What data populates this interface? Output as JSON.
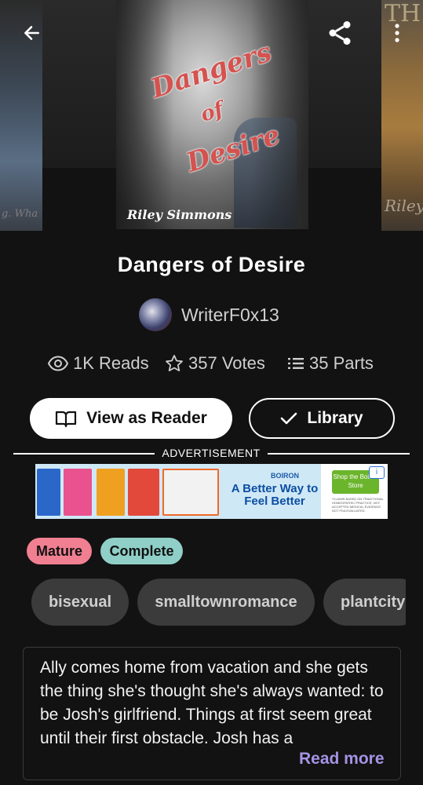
{
  "nav": {
    "back_icon": "arrow-left-icon",
    "share_icon": "share-icon",
    "more_icon": "more-vertical-icon"
  },
  "cover": {
    "title_line1": "Dangers",
    "title_line2": "of",
    "title_line3": "Desire",
    "author": "Riley Simmons",
    "left_neighbor_text": "g. Wha",
    "right_neighbor_text": "Riley",
    "right_neighbor_top": "TH"
  },
  "story": {
    "title": "Dangers of Desire",
    "author": "WriterF0x13"
  },
  "stats": {
    "reads": "1K Reads",
    "votes": "357 Votes",
    "parts": "35 Parts"
  },
  "actions": {
    "view_as_reader": "View as Reader",
    "library": "Library"
  },
  "ad": {
    "label": "ADVERTISEMENT",
    "brand": "BOIRON",
    "headline": "A Better Way to Feel Better",
    "shop_button": "Shop the Boiron Store",
    "fine_print": "*CLAIMS BASED ON TRADITIONAL HOMEOPATHIC PRACTICE, NOT ACCEPTED MEDICAL EVIDENCE. NOT FDA EVALUATED.",
    "info": "i"
  },
  "badges": [
    "Mature",
    "Complete"
  ],
  "tags": [
    "bisexual",
    "smalltownromance",
    "plantcity"
  ],
  "description": {
    "text": "Ally comes home from vacation and she gets the thing she's thought she's always wanted: to be Josh's girlfriend. Things at first seem great until their first obstacle. Josh has a",
    "read_more": "Read more"
  },
  "colors": {
    "background": "#121212",
    "mature": "#f17f92",
    "complete": "#8fcfc7",
    "read_more": "#a493e4"
  }
}
